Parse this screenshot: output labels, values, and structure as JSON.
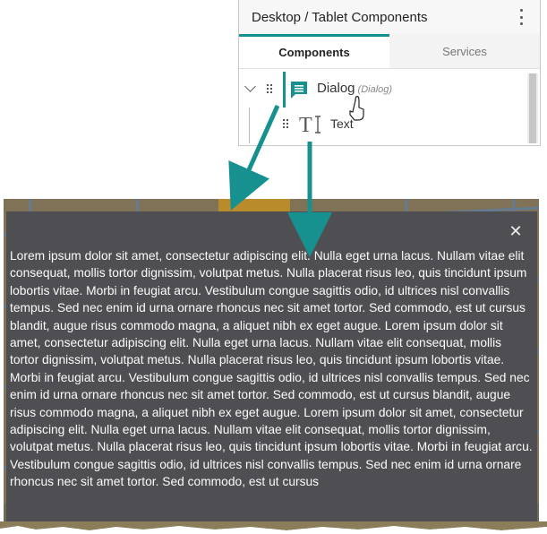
{
  "panel": {
    "title": "Desktop / Tablet Components",
    "tabs": [
      {
        "label": "Components",
        "active": true
      },
      {
        "label": "Services",
        "active": false
      }
    ],
    "tree": {
      "dialog": {
        "label": "Dialog",
        "type": "(Dialog)"
      },
      "text": {
        "label": "Text"
      }
    }
  },
  "dialog": {
    "body_text": "Lorem ipsum dolor sit amet, consectetur adipiscing elit. Nulla eget urna lacus. Nullam vitae elit consequat, mollis tortor dignissim, volutpat metus. Nulla placerat risus leo, quis tincidunt ipsum lobortis vitae. Morbi in feugiat arcu. Vestibulum congue sagittis odio, id ultrices nisl convallis tempus. Sed nec enim id urna ornare rhoncus nec sit amet tortor. Sed commodo, est ut cursus blandit, augue risus commodo magna, a aliquet nibh ex eget augue. Lorem ipsum dolor sit amet, consectetur adipiscing elit. Nulla eget urna lacus. Nullam vitae elit consequat, mollis tortor dignissim, volutpat metus. Nulla placerat risus leo, quis tincidunt ipsum lobortis vitae. Morbi in feugiat arcu. Vestibulum congue sagittis odio, id ultrices nisl convallis tempus. Sed nec enim id urna ornare rhoncus nec sit amet tortor. Sed commodo, est ut cursus blandit, augue risus commodo magna, a aliquet nibh ex eget augue. Lorem ipsum dolor sit amet, consectetur adipiscing elit. Nulla eget urna lacus. Nullam vitae elit consequat, mollis tortor dignissim, volutpat metus. Nulla placerat risus leo, quis tincidunt ipsum lobortis vitae. Morbi in feugiat arcu. Vestibulum congue sagittis odio, id ultrices nisl convallis tempus. Sed nec enim id urna ornare rhoncus nec sit amet tortor. Sed commodo, est ut cursus",
    "close_icon": "close-icon"
  },
  "colors": {
    "accent": "#17918f",
    "dialog_bg": "#4f4f53"
  }
}
